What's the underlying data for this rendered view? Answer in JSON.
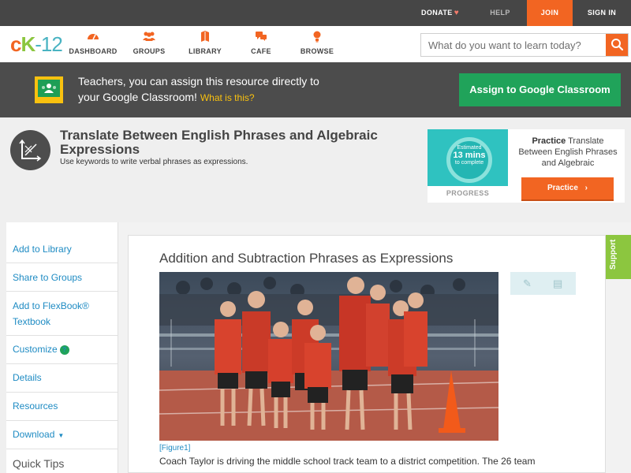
{
  "topbar": {
    "donate": "DONATE",
    "help": "HELP",
    "join": "JOIN",
    "signin": "SIGN IN"
  },
  "nav": {
    "logo": {
      "c": "c",
      "k": "K",
      "n": "-12"
    },
    "items": [
      {
        "label": "DASHBOARD",
        "icon": "dashboard-icon"
      },
      {
        "label": "GROUPS",
        "icon": "groups-icon"
      },
      {
        "label": "LIBRARY",
        "icon": "library-icon"
      },
      {
        "label": "CAFE",
        "icon": "cafe-icon"
      },
      {
        "label": "BROWSE",
        "icon": "browse-icon"
      }
    ],
    "search_placeholder": "What do you want to learn today?"
  },
  "banner": {
    "line1": "Teachers, you can assign this resource directly to",
    "line2": "your Google Classroom!",
    "what": "What is this?",
    "assign_button": "Assign to Google Classroom"
  },
  "concept": {
    "title": "Translate Between English Phrases and Algebraic Expressions",
    "subtitle": "Use keywords to write verbal phrases as expressions.",
    "practice_card": {
      "estimated": "Estimated",
      "minutes": "13 mins",
      "to_complete": "to complete",
      "progress_label": "PROGRESS",
      "title_bold": "Practice",
      "title_rest": "Translate Between English Phrases and Algebraic",
      "button": "Practice"
    }
  },
  "sidebar": {
    "items": [
      {
        "label": "Add to Library"
      },
      {
        "label": "Share to Groups"
      },
      {
        "label": "Add to FlexBook® Textbook"
      },
      {
        "label": "Customize"
      },
      {
        "label": "Details"
      },
      {
        "label": "Resources"
      },
      {
        "label": "Download"
      }
    ],
    "tips": "Quick Tips"
  },
  "content": {
    "lesson_title": "Addition and Subtraction Phrases as Expressions",
    "figure_link": "[Figure1]",
    "paragraph": "Coach Taylor is driving the middle school track team to a district competition. The 26 team"
  },
  "support": "Support",
  "colors": {
    "accent_orange": "#f26522",
    "brand_green": "#8cc63f",
    "link_blue": "#1e8bc3",
    "classroom_green": "#20a35a"
  }
}
